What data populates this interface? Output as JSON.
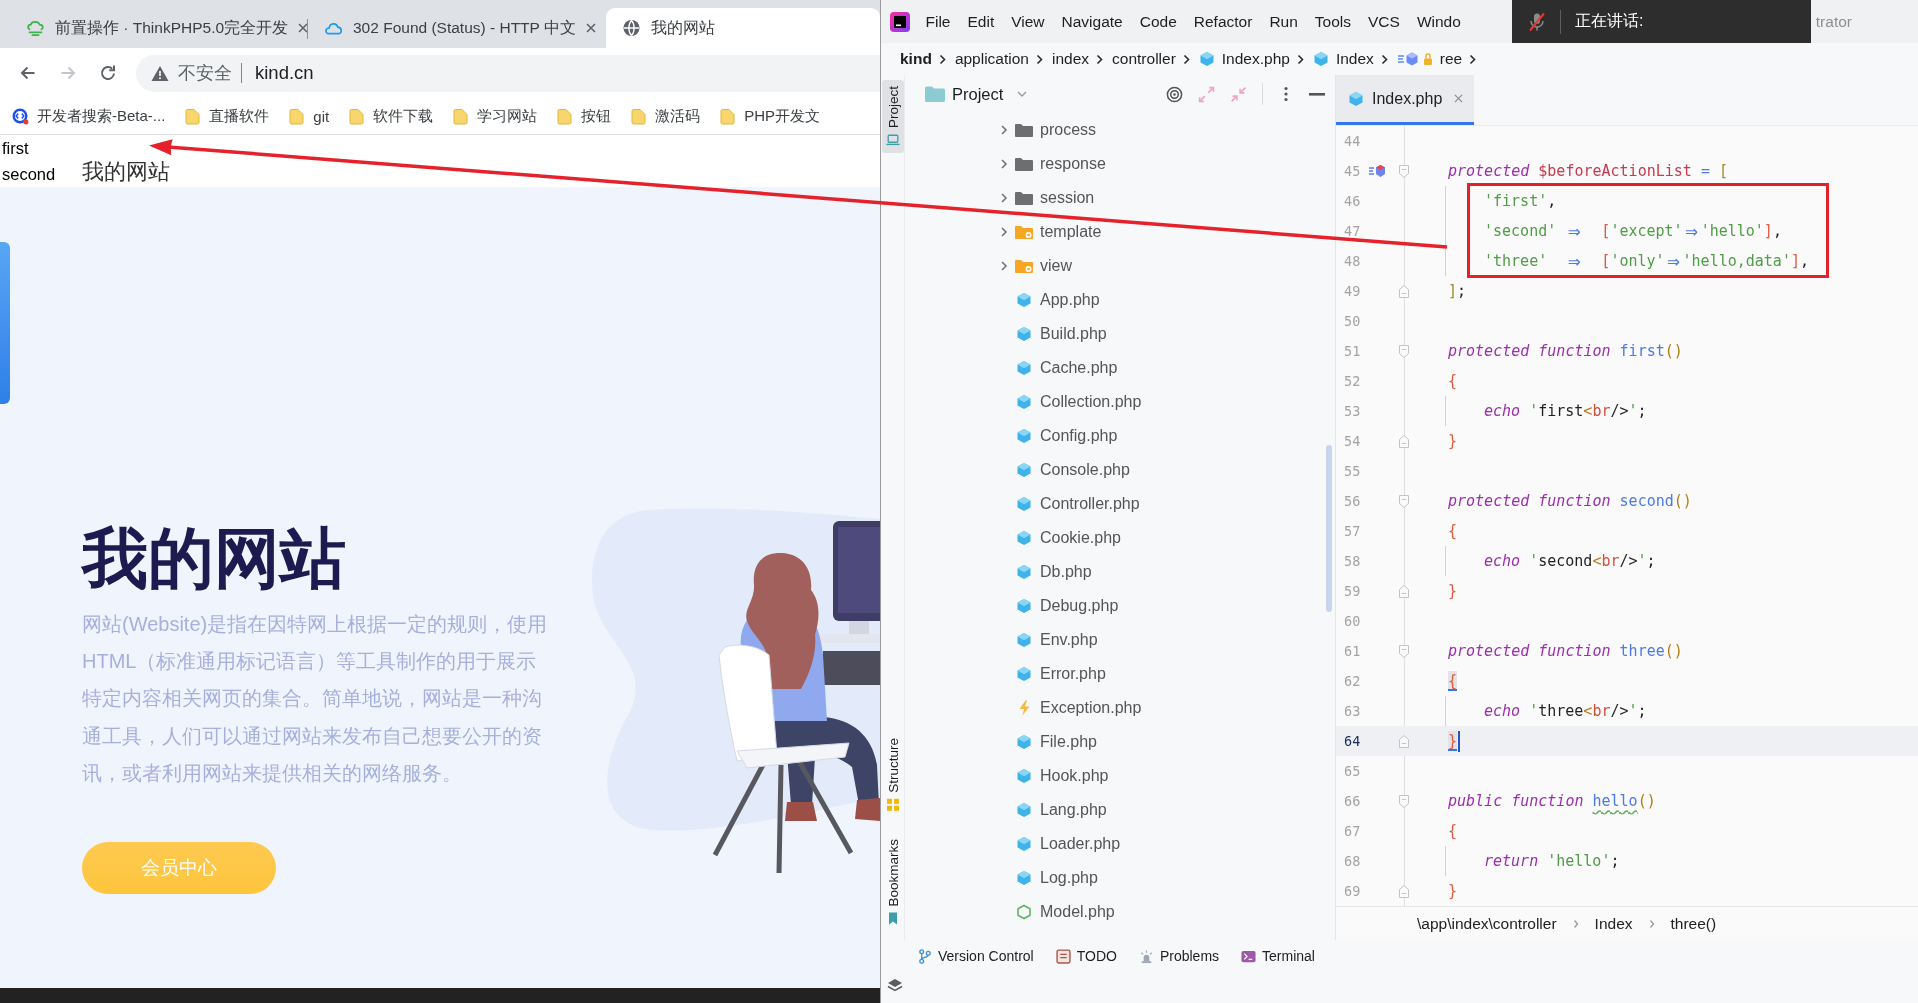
{
  "browser": {
    "tabs": [
      {
        "title": "前置操作 · ThinkPHP5.0完全开发",
        "kind": "docs",
        "selected": false
      },
      {
        "title": "302 Found (Status) - HTTP 中文",
        "kind": "cloud",
        "selected": false
      },
      {
        "title": "我的网站",
        "kind": "globe",
        "selected": true
      }
    ],
    "toolbar": {
      "back_disabled": false,
      "forward_disabled": true
    },
    "address": {
      "security": "不安全",
      "url": "kind.cn"
    },
    "bookmarks": [
      {
        "label": "开发者搜索-Beta-...",
        "kind": "search"
      },
      {
        "label": "直播软件",
        "kind": "folder"
      },
      {
        "label": "git",
        "kind": "folder"
      },
      {
        "label": "软件下载",
        "kind": "folder"
      },
      {
        "label": "学习网站",
        "kind": "folder"
      },
      {
        "label": "按钮",
        "kind": "folder"
      },
      {
        "label": "激活码",
        "kind": "folder"
      },
      {
        "label": "PHP开发文",
        "kind": "folder"
      }
    ],
    "page": {
      "output": [
        "first",
        "second"
      ],
      "nav_title": "我的网站",
      "hero": {
        "title": "我的网站",
        "description": "网站(Website)是指在因特网上根据一定的规则，使用HTML（标准通用标记语言）等工具制作的用于展示特定内容相关网页的集合。简单地说，网站是一种沟通工具，人们可以通过网站来发布自己想要公开的资讯，或者利用网站来提供相关的网络服务。",
        "button": "会员中心"
      }
    }
  },
  "ide": {
    "menu": [
      "File",
      "Edit",
      "View",
      "Navigate",
      "Code",
      "Refactor",
      "Run",
      "Tools",
      "VCS",
      "Windo"
    ],
    "title_fragment": "trator",
    "voice_overlay": {
      "label": "正在讲话:",
      "muted": true
    },
    "breadcrumb": [
      {
        "label": "kind",
        "kind": "project"
      },
      {
        "label": "application",
        "kind": "folder"
      },
      {
        "label": "index",
        "kind": "folder"
      },
      {
        "label": "controller",
        "kind": "folder"
      },
      {
        "label": "Index.php",
        "kind": "file"
      },
      {
        "label": "Index",
        "kind": "class"
      },
      {
        "label": "ree",
        "kind": "method"
      }
    ],
    "tool_stripe": {
      "top": [
        {
          "label": "Project",
          "kind": "project",
          "selected": true
        }
      ],
      "bottom": [
        {
          "label": "Structure",
          "kind": "structure",
          "selected": false
        },
        {
          "label": "Bookmarks",
          "kind": "bookmarks",
          "selected": false
        }
      ]
    },
    "project": {
      "title": "Project",
      "tree": [
        {
          "name": "process",
          "kind": "folder",
          "expanded": false
        },
        {
          "name": "response",
          "kind": "folder",
          "expanded": false
        },
        {
          "name": "session",
          "kind": "folder",
          "expanded": false
        },
        {
          "name": "template",
          "kind": "resource-folder",
          "expanded": false
        },
        {
          "name": "view",
          "kind": "resource-folder",
          "expanded": false
        },
        {
          "name": "App.php",
          "kind": "php"
        },
        {
          "name": "Build.php",
          "kind": "php"
        },
        {
          "name": "Cache.php",
          "kind": "php"
        },
        {
          "name": "Collection.php",
          "kind": "php"
        },
        {
          "name": "Config.php",
          "kind": "php"
        },
        {
          "name": "Console.php",
          "kind": "php"
        },
        {
          "name": "Controller.php",
          "kind": "php"
        },
        {
          "name": "Cookie.php",
          "kind": "php"
        },
        {
          "name": "Db.php",
          "kind": "php"
        },
        {
          "name": "Debug.php",
          "kind": "php"
        },
        {
          "name": "Env.php",
          "kind": "php"
        },
        {
          "name": "Error.php",
          "kind": "php"
        },
        {
          "name": "Exception.php",
          "kind": "exception"
        },
        {
          "name": "File.php",
          "kind": "php"
        },
        {
          "name": "Hook.php",
          "kind": "php"
        },
        {
          "name": "Lang.php",
          "kind": "php"
        },
        {
          "name": "Loader.php",
          "kind": "php"
        },
        {
          "name": "Log.php",
          "kind": "php"
        },
        {
          "name": "Model.php",
          "kind": "model"
        }
      ]
    },
    "editor": {
      "tabs": [
        {
          "label": "Index.php",
          "selected": true
        }
      ],
      "lines": [
        {
          "number": "44",
          "current": false
        },
        {
          "number": "45",
          "current": false,
          "fold_start": true,
          "marker": true,
          "tokens": [
            {
              "text": "protected ",
              "kind": "keyword"
            },
            {
              "text": "$beforeActionList ",
              "kind": "variable"
            },
            {
              "text": "= ",
              "kind": "operator"
            },
            {
              "text": "[",
              "kind": "bracket"
            }
          ],
          "children": [
            {
              "number": "46",
              "current": false,
              "tokens": [
                {
                  "text": "'first'",
                  "kind": "string"
                },
                {
                  "text": ",",
                  "kind": "punct"
                }
              ]
            },
            {
              "number": "47",
              "current": false,
              "tokens": [
                {
                  "text": "'second' ",
                  "kind": "string"
                },
                {
                  "text": "⇒",
                  "kind": "arrow"
                },
                {
                  "text": "  [",
                  "kind": "bracket-inner"
                },
                {
                  "text": "'except'",
                  "kind": "string"
                },
                {
                  "text": "⇒",
                  "kind": "arrow"
                },
                {
                  "text": "'hello'",
                  "kind": "string"
                },
                {
                  "text": "]",
                  "kind": "bracket-inner"
                },
                {
                  "text": ",",
                  "kind": "punct"
                }
              ]
            },
            {
              "number": "48",
              "current": false,
              "tokens": [
                {
                  "text": "'three'  ",
                  "kind": "string"
                },
                {
                  "text": "⇒",
                  "kind": "arrow"
                },
                {
                  "text": "  [",
                  "kind": "bracket-inner"
                },
                {
                  "text": "'only'",
                  "kind": "string"
                },
                {
                  "text": "⇒",
                  "kind": "arrow"
                },
                {
                  "text": "'hello,data'",
                  "kind": "string"
                },
                {
                  "text": "]",
                  "kind": "bracket-inner"
                },
                {
                  "text": ",",
                  "kind": "punct"
                }
              ]
            }
          ]
        },
        {
          "number": "49",
          "current": false,
          "fold_end": true,
          "tokens": [
            {
              "text": "]",
              "kind": "bracket"
            },
            {
              "text": ";",
              "kind": "punct"
            }
          ]
        },
        {
          "number": "50",
          "current": false
        },
        {
          "number": "51",
          "current": false,
          "fold_start": true,
          "tokens": [
            {
              "text": "protected ",
              "kind": "keyword"
            },
            {
              "text": "function ",
              "kind": "keyword"
            },
            {
              "text": "first",
              "kind": "function"
            },
            {
              "text": "()",
              "kind": "paren"
            }
          ]
        },
        {
          "number": "52",
          "current": false,
          "tokens": [
            {
              "text": "{",
              "kind": "brace"
            }
          ],
          "children": [
            {
              "number": "53",
              "current": false,
              "tokens": [
                {
                  "text": "echo ",
                  "kind": "keyword"
                },
                {
                  "text": "'",
                  "kind": "string"
                },
                {
                  "text": "first",
                  "kind": "text"
                },
                {
                  "text": "<",
                  "kind": "tag-open"
                },
                {
                  "text": "br",
                  "kind": "tag"
                },
                {
                  "text": "/>",
                  "kind": "tag-close"
                },
                {
                  "text": "'",
                  "kind": "string"
                },
                {
                  "text": ";",
                  "kind": "punct"
                }
              ]
            }
          ]
        },
        {
          "number": "54",
          "current": false,
          "fold_end": true,
          "tokens": [
            {
              "text": "}",
              "kind": "brace"
            }
          ]
        },
        {
          "number": "55",
          "current": false
        },
        {
          "number": "56",
          "current": false,
          "fold_start": true,
          "tokens": [
            {
              "text": "protected ",
              "kind": "keyword"
            },
            {
              "text": "function ",
              "kind": "keyword"
            },
            {
              "text": "second",
              "kind": "function"
            },
            {
              "text": "()",
              "kind": "paren"
            }
          ]
        },
        {
          "number": "57",
          "current": false,
          "tokens": [
            {
              "text": "{",
              "kind": "brace"
            }
          ],
          "children": [
            {
              "number": "58",
              "current": false,
              "tokens": [
                {
                  "text": "echo ",
                  "kind": "keyword"
                },
                {
                  "text": "'",
                  "kind": "string"
                },
                {
                  "text": "second",
                  "kind": "text"
                },
                {
                  "text": "<",
                  "kind": "tag-open"
                },
                {
                  "text": "br",
                  "kind": "tag"
                },
                {
                  "text": "/>",
                  "kind": "tag-close"
                },
                {
                  "text": "'",
                  "kind": "string"
                },
                {
                  "text": ";",
                  "kind": "punct"
                }
              ]
            }
          ]
        },
        {
          "number": "59",
          "current": false,
          "fold_end": true,
          "tokens": [
            {
              "text": "}",
              "kind": "brace"
            }
          ]
        },
        {
          "number": "60",
          "current": false
        },
        {
          "number": "61",
          "current": false,
          "fold_start": true,
          "tokens": [
            {
              "text": "protected ",
              "kind": "keyword"
            },
            {
              "text": "function ",
              "kind": "keyword"
            },
            {
              "text": "three",
              "kind": "function"
            },
            {
              "text": "()",
              "kind": "paren"
            }
          ]
        },
        {
          "number": "62",
          "current": false,
          "tokens": [
            {
              "text": "{",
              "kind": "brace-matched"
            }
          ],
          "children": [
            {
              "number": "63",
              "current": false,
              "tokens": [
                {
                  "text": "echo ",
                  "kind": "keyword"
                },
                {
                  "text": "'",
                  "kind": "string"
                },
                {
                  "text": "three",
                  "kind": "text"
                },
                {
                  "text": "<",
                  "kind": "tag-open"
                },
                {
                  "text": "br",
                  "kind": "tag"
                },
                {
                  "text": "/>",
                  "kind": "tag-close"
                },
                {
                  "text": "'",
                  "kind": "string"
                },
                {
                  "text": ";",
                  "kind": "punct"
                }
              ]
            }
          ]
        },
        {
          "number": "64",
          "current": true,
          "fold_end": true,
          "tokens": [
            {
              "text": "}",
              "kind": "brace-matched"
            }
          ]
        },
        {
          "number": "65",
          "current": false
        },
        {
          "number": "66",
          "current": false,
          "fold_start": true,
          "tokens": [
            {
              "text": "public ",
              "kind": "keyword"
            },
            {
              "text": "function ",
              "kind": "keyword"
            },
            {
              "text": "hello",
              "kind": "function-flagged"
            },
            {
              "text": "()",
              "kind": "paren"
            }
          ]
        },
        {
          "number": "67",
          "current": false,
          "tokens": [
            {
              "text": "{",
              "kind": "brace"
            }
          ],
          "children": [
            {
              "number": "68",
              "current": false,
              "tokens": [
                {
                  "text": "return ",
                  "kind": "keyword"
                },
                {
                  "text": "'hello'",
                  "kind": "string"
                },
                {
                  "text": ";",
                  "kind": "punct"
                }
              ]
            }
          ]
        },
        {
          "number": "69",
          "current": false,
          "fold_end": true,
          "tokens": [
            {
              "text": "}",
              "kind": "brace"
            }
          ]
        }
      ],
      "breadcrumb": [
        "\\app\\index\\controller",
        "Index",
        "three()"
      ]
    },
    "bottom_tools": [
      {
        "label": "Version Control",
        "kind": "vcs"
      },
      {
        "label": "TODO",
        "kind": "todo"
      },
      {
        "label": "Problems",
        "kind": "problems"
      },
      {
        "label": "Terminal",
        "kind": "terminal"
      }
    ]
  }
}
